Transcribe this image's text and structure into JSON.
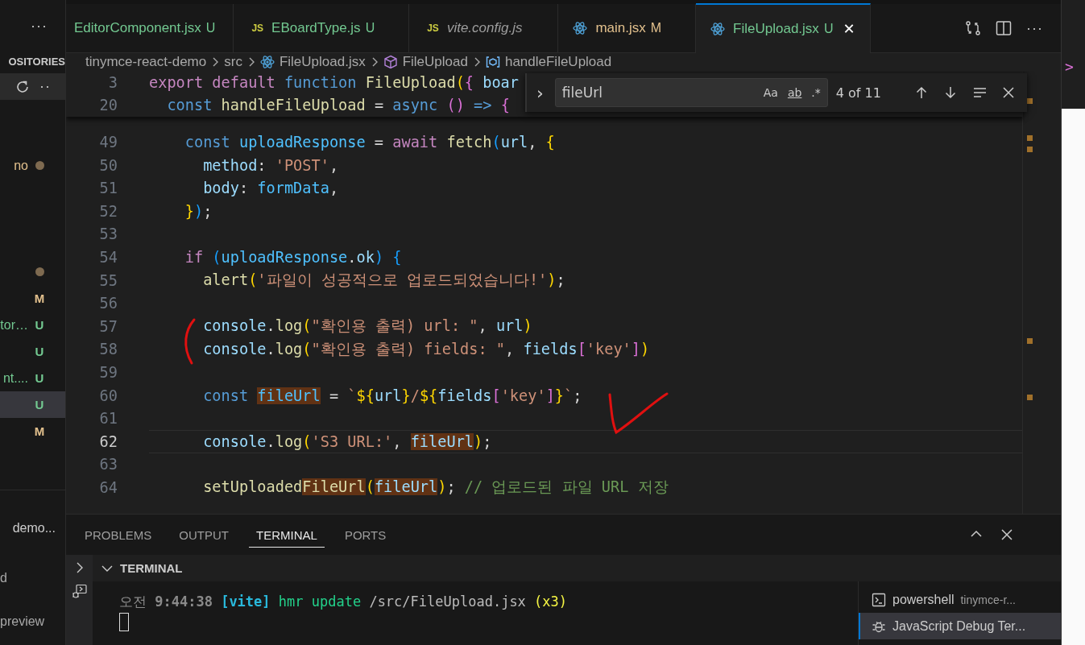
{
  "sidebar": {
    "more": "···",
    "header": "OSITORIES",
    "toolbar": {
      "refresh": true,
      "more": "··"
    },
    "groups": [
      [
        {
          "label": "no",
          "color": "#e2c08d",
          "kind": "dot",
          "selected": false
        }
      ],
      [
        {
          "kind": "dot",
          "selected": false
        },
        {
          "kind": "badge",
          "badge": "M",
          "color": "#e2c08d",
          "selected": false
        },
        {
          "kind": "badge",
          "label": "tor…",
          "color": "#73c991",
          "badge": "U",
          "selected": false
        },
        {
          "kind": "badge",
          "badge": "U",
          "color": "#73c991",
          "selected": false
        },
        {
          "kind": "badge",
          "label": "nt....",
          "color": "#73c991",
          "badge": "U",
          "selected": false
        },
        {
          "kind": "badge",
          "badge": "U",
          "color": "#73c991",
          "selected": true
        },
        {
          "kind": "badge",
          "badge": "M",
          "color": "#e2c08d",
          "selected": false
        }
      ]
    ],
    "lower": [
      "demo...",
      "d",
      "preview"
    ]
  },
  "tabs": [
    {
      "label": "EditorComponent.jsx",
      "kind": "plain",
      "color": "#73c991",
      "badge": "U",
      "preview": false,
      "selected": false
    },
    {
      "label": "EBoardType.js",
      "kind": "js",
      "icon_label": "JS",
      "color": "#73c991",
      "badge": "U",
      "preview": false,
      "selected": false
    },
    {
      "label": "vite.config.js",
      "kind": "js",
      "icon_label": "JS",
      "preview": true,
      "selected": false
    },
    {
      "label": "main.jsx",
      "kind": "react",
      "color": "#e2c08d",
      "badge": "M",
      "preview": false,
      "selected": false
    },
    {
      "label": "FileUpload.jsx",
      "kind": "react",
      "color": "#73c991",
      "badge": "U",
      "preview": false,
      "selected": true,
      "close": "✕"
    }
  ],
  "tab_actions": {
    "more": "···"
  },
  "breadcrumb": [
    {
      "label": "tinymce-react-demo",
      "kind": "plain"
    },
    {
      "label": "src",
      "kind": "plain"
    },
    {
      "label": "FileUpload.jsx",
      "kind": "file"
    },
    {
      "label": "FileUpload",
      "kind": "class"
    },
    {
      "label": "handleFileUpload",
      "kind": "variable"
    }
  ],
  "find": {
    "toggle": "›",
    "value": "fileUrl",
    "options": [
      {
        "label": "Aa",
        "on": false
      },
      {
        "label": "ab",
        "on": false
      },
      {
        "label": ".*",
        "on": false
      }
    ],
    "count": "4 of 11"
  },
  "sticky": [
    {
      "num": "3",
      "tokens": [
        {
          "t": "export",
          "kind": "kw"
        },
        {
          "t": " default",
          "kind": "kw"
        },
        {
          "t": " function",
          "kind": "stor"
        },
        {
          "t": " FileUpload",
          "kind": "fn"
        },
        {
          "t": "(",
          "kind": "b1"
        },
        {
          "t": "{",
          "kind": "b2"
        },
        {
          "t": " boar",
          "kind": "var"
        }
      ]
    },
    {
      "num": "20",
      "tokens": [
        {
          "t": "  const",
          "kind": "stor"
        },
        {
          "t": " handleFileUpload",
          "kind": "fn"
        },
        {
          "t": " = "
        },
        {
          "t": "async",
          "kind": "stor"
        },
        {
          "t": " ()",
          "kind": "b2"
        },
        {
          "t": " =>",
          "kind": "stor"
        },
        {
          "t": " {",
          "kind": "b2"
        }
      ]
    }
  ],
  "lines": [
    {
      "num": "49",
      "current": false,
      "tokens": [
        {
          "t": "    const",
          "kind": "stor"
        },
        {
          "t": " uploadResponse",
          "kind": "const"
        },
        {
          "t": " = "
        },
        {
          "t": "await",
          "kind": "kw"
        },
        {
          "t": " fetch",
          "kind": "fn"
        },
        {
          "t": "(",
          "kind": "b3"
        },
        {
          "t": "url",
          "kind": "var"
        },
        {
          "t": ", "
        },
        {
          "t": "{",
          "kind": "b1"
        }
      ]
    },
    {
      "num": "50",
      "current": false,
      "tokens": [
        {
          "t": "      method",
          "kind": "var"
        },
        {
          "t": ": "
        },
        {
          "t": "'POST'",
          "kind": "str"
        },
        {
          "t": ","
        }
      ]
    },
    {
      "num": "51",
      "current": false,
      "tokens": [
        {
          "t": "      body",
          "kind": "var"
        },
        {
          "t": ": "
        },
        {
          "t": "formData",
          "kind": "const"
        },
        {
          "t": ","
        }
      ]
    },
    {
      "num": "52",
      "current": false,
      "tokens": [
        {
          "t": "    }",
          "kind": "b1"
        },
        {
          "t": ")",
          "kind": "b3"
        },
        {
          "t": ";"
        }
      ]
    },
    {
      "num": "53",
      "current": false
    },
    {
      "num": "54",
      "current": false,
      "tokens": [
        {
          "t": "    if",
          "kind": "kw"
        },
        {
          "t": " (",
          "kind": "b3"
        },
        {
          "t": "uploadResponse",
          "kind": "const"
        },
        {
          "t": "."
        },
        {
          "t": "ok",
          "kind": "var"
        },
        {
          "t": ")",
          "kind": "b3"
        },
        {
          "t": " {",
          "kind": "b3"
        }
      ]
    },
    {
      "num": "55",
      "current": false,
      "tokens": [
        {
          "t": "      alert",
          "kind": "fn"
        },
        {
          "t": "(",
          "kind": "b1"
        },
        {
          "t": "'파일이 성공적으로 업로드되었습니다!'",
          "kind": "str"
        },
        {
          "t": ")",
          "kind": "b1"
        },
        {
          "t": ";"
        }
      ]
    },
    {
      "num": "56",
      "current": false
    },
    {
      "num": "57",
      "current": false,
      "tokens": [
        {
          "t": "      console",
          "kind": "var"
        },
        {
          "t": "."
        },
        {
          "t": "log",
          "kind": "fn"
        },
        {
          "t": "(",
          "kind": "b1"
        },
        {
          "t": "\"확인용 출력) url: \"",
          "kind": "str"
        },
        {
          "t": ", "
        },
        {
          "t": "url",
          "kind": "var"
        },
        {
          "t": ")",
          "kind": "b1"
        }
      ]
    },
    {
      "num": "58",
      "current": false,
      "tokens": [
        {
          "t": "      console",
          "kind": "var"
        },
        {
          "t": "."
        },
        {
          "t": "log",
          "kind": "fn"
        },
        {
          "t": "(",
          "kind": "b1"
        },
        {
          "t": "\"확인용 출력) fields: \"",
          "kind": "str"
        },
        {
          "t": ", "
        },
        {
          "t": "fields",
          "kind": "var"
        },
        {
          "t": "[",
          "kind": "b2"
        },
        {
          "t": "'key'",
          "kind": "str"
        },
        {
          "t": "]",
          "kind": "b2"
        },
        {
          "t": ")",
          "kind": "b1"
        }
      ]
    },
    {
      "num": "59",
      "current": false
    },
    {
      "num": "60",
      "current": false,
      "tokens": [
        {
          "t": "      const ",
          "kind": "stor"
        },
        {
          "t": "fileUrl",
          "kind": "const",
          "match": true
        },
        {
          "t": " = "
        },
        {
          "t": "`",
          "kind": "str"
        },
        {
          "t": "${",
          "kind": "b1"
        },
        {
          "t": "url",
          "kind": "var"
        },
        {
          "t": "}",
          "kind": "b1"
        },
        {
          "t": "/",
          "kind": "str"
        },
        {
          "t": "${",
          "kind": "b1"
        },
        {
          "t": "fields",
          "kind": "var"
        },
        {
          "t": "[",
          "kind": "b2"
        },
        {
          "t": "'key'",
          "kind": "str"
        },
        {
          "t": "]",
          "kind": "b2"
        },
        {
          "t": "}",
          "kind": "b1"
        },
        {
          "t": "`",
          "kind": "str"
        },
        {
          "t": ";"
        }
      ]
    },
    {
      "num": "61",
      "current": false
    },
    {
      "num": "62",
      "current": true,
      "tokens": [
        {
          "t": "      console",
          "kind": "var"
        },
        {
          "t": "."
        },
        {
          "t": "log",
          "kind": "fn"
        },
        {
          "t": "(",
          "kind": "b1"
        },
        {
          "t": "'S3 URL:'",
          "kind": "str"
        },
        {
          "t": ", "
        },
        {
          "t": "fileUrl",
          "kind": "var",
          "match": true
        },
        {
          "t": ")",
          "kind": "b1"
        },
        {
          "t": ";"
        }
      ]
    },
    {
      "num": "63",
      "current": false
    },
    {
      "num": "64",
      "current": false,
      "tokens": [
        {
          "t": "      setUploaded",
          "kind": "fn"
        },
        {
          "t": "FileUrl",
          "kind": "fn",
          "match": true
        },
        {
          "t": "(",
          "kind": "b1"
        },
        {
          "t": "fileUrl",
          "kind": "var",
          "match": true
        },
        {
          "t": ")",
          "kind": "b1"
        },
        {
          "t": "; "
        },
        {
          "t": "// 업로드된 파일 URL 저장",
          "kind": "cm"
        }
      ]
    }
  ],
  "panel": {
    "tabs": [
      {
        "label": "PROBLEMS",
        "selected": false
      },
      {
        "label": "OUTPUT",
        "selected": false
      },
      {
        "label": "TERMINAL",
        "selected": true
      },
      {
        "label": "PORTS",
        "selected": false
      }
    ],
    "section": "TERMINAL",
    "expanded": true,
    "terminal_line": [
      {
        "t": "오전 ",
        "kind": "dim"
      },
      {
        "t": "9:44:38 ",
        "kind": "dimb"
      },
      {
        "t": "[vite]",
        "kind": "cyan"
      },
      {
        "t": " hmr update ",
        "kind": "green"
      },
      {
        "t": "/src/FileUpload.jsx ",
        "kind": "plain"
      },
      {
        "t": "(x3)",
        "kind": "yellow"
      }
    ],
    "terminals": [
      {
        "name": "powershell",
        "detail": "tinymce-r...",
        "kind": "shell",
        "selected": false
      },
      {
        "name": "JavaScript Debug Ter...",
        "kind": "debug",
        "selected": true
      }
    ]
  },
  "other_window": {
    "tokens": [
      {
        "t": ">",
        "kind": "b2"
      }
    ]
  }
}
